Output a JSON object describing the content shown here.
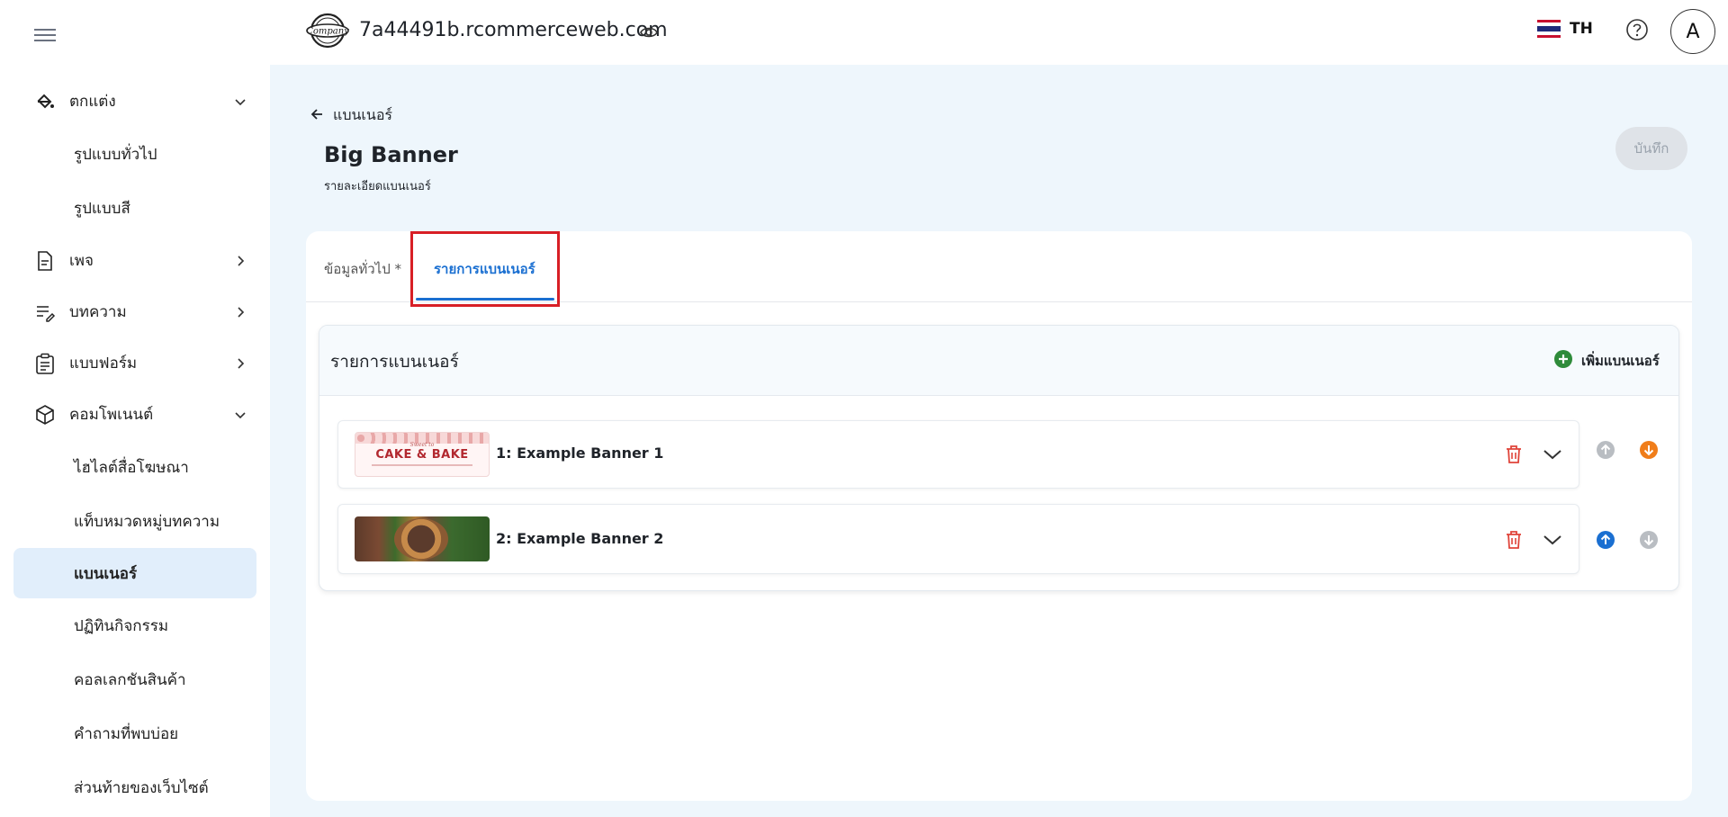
{
  "topbar": {
    "logo_text": "Company",
    "site_name": "7a44491b.rcommerceweb.com",
    "language_code": "TH",
    "avatar_initial": "A"
  },
  "sidebar": {
    "items": [
      {
        "label": "ตกแต่ง",
        "icon": "paint-bucket-icon",
        "expanded": true
      },
      {
        "label": "รูปแบบทั่วไป",
        "sub": true
      },
      {
        "label": "รูปแบบสี",
        "sub": true
      },
      {
        "label": "เพจ",
        "icon": "page-icon",
        "expanded": false
      },
      {
        "label": "บทความ",
        "icon": "article-edit-icon",
        "expanded": false
      },
      {
        "label": "แบบฟอร์ม",
        "icon": "form-clipboard-icon",
        "expanded": false
      },
      {
        "label": "คอมโพเนนต์",
        "icon": "component-box-icon",
        "expanded": true
      },
      {
        "label": "ไฮไลต์สื่อโฆษณา",
        "sub": true
      },
      {
        "label": "แท็บหมวดหมู่บทความ",
        "sub": true
      },
      {
        "label": "แบนเนอร์",
        "sub": true,
        "active": true
      },
      {
        "label": "ปฏิทินกิจกรรม",
        "sub": true
      },
      {
        "label": "คอลเลกชันสินค้า",
        "sub": true
      },
      {
        "label": "คำถามที่พบบ่อย",
        "sub": true
      },
      {
        "label": "ส่วนท้ายของเว็บไซต์",
        "sub": true
      }
    ]
  },
  "header": {
    "back_label": "แบนเนอร์",
    "title": "Big Banner",
    "subtitle": "รายละเอียดแบนเนอร์",
    "save_label": "บันทึก"
  },
  "tabs": [
    {
      "label": "ข้อมูลทั่วไป *",
      "active": false
    },
    {
      "label": "รายการแบนเนอร์",
      "active": true
    }
  ],
  "banner_list": {
    "title": "รายการแบนเนอร์",
    "add_label": "เพิ่มแบนเนอร์",
    "rows": [
      {
        "name": "1: Example Banner 1",
        "thumb_small": "Sweet to",
        "thumb_big": "CAKE & BAKE",
        "up_enabled": false,
        "down_enabled": true
      },
      {
        "name": "2: Example Banner 2",
        "up_enabled": true,
        "down_enabled": false
      }
    ]
  },
  "colors": {
    "accent_blue": "#1a6fd1",
    "delete_red": "#e0443a",
    "add_green": "#2e8b3a",
    "down_orange": "#f07d1a",
    "highlight_red": "#d81f26"
  }
}
